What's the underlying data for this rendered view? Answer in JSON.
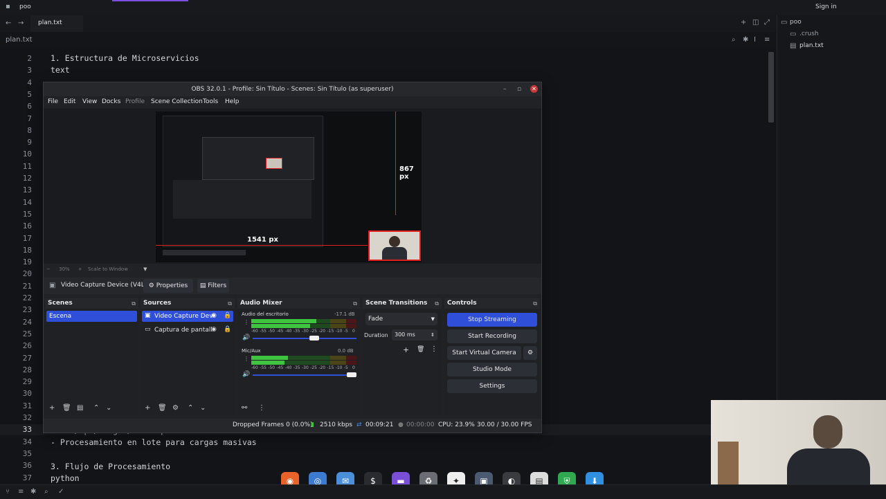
{
  "topbar": {
    "app": "poo",
    "signin": "Sign in"
  },
  "tab": {
    "label": "plan.txt"
  },
  "file_header": {
    "name": "plan.txt"
  },
  "sidebar": {
    "root": "poo",
    "items": [
      {
        "label": ".crush"
      },
      {
        "label": "plan.txt"
      }
    ]
  },
  "editor": {
    "line_numbers": [
      "2",
      "3",
      "4",
      "5",
      "6",
      "7",
      "8",
      "9",
      "10",
      "11",
      "12",
      "13",
      "14",
      "15",
      "16",
      "17",
      "18",
      "19",
      "20",
      "21",
      "22",
      "23",
      "24",
      "25",
      "26",
      "27",
      "28",
      "29",
      "30",
      "31",
      "32",
      "33",
      "34",
      "35",
      "36",
      "37"
    ],
    "lines": {
      "l2": "1. Estructura de Microservicios",
      "l3": "text",
      "l33": "POST /api/images/batch-process",
      "l34": "- Procesamiento en lote para cargas masivas",
      "l36": "3. Flujo de Procesamiento",
      "l37": "python"
    }
  },
  "obs": {
    "title": "OBS 32.0.1 - Profile: Sin Título - Scenes: Sin Título (as superuser)",
    "menu": [
      "File",
      "Edit",
      "View",
      "Docks",
      "Profile",
      "Scene Collection",
      "Tools",
      "Help"
    ],
    "preview": {
      "height_label": "867 px",
      "width_label": "1541 px",
      "zoom": "30%",
      "scale_mode": "Scale to Window"
    },
    "source_bar": {
      "source": "Video Capture Device (V4L",
      "properties": "Properties",
      "filters": "Filters"
    },
    "scenes": {
      "title": "Scenes",
      "items": [
        "Escena"
      ]
    },
    "sources": {
      "title": "Sources",
      "items": [
        "Video Capture Dev",
        "Captura de pantall"
      ]
    },
    "mixer": {
      "title": "Audio Mixer",
      "channels": [
        {
          "name": "Audio del escritorio",
          "db": "-17.1 dB",
          "level": 0.62,
          "volume": 0.6
        },
        {
          "name": "Mic/Aux",
          "db": "0.0 dB",
          "level": 0.35,
          "volume": 1.0
        }
      ],
      "scale": [
        "-60",
        "-55",
        "-50",
        "-45",
        "-40",
        "-35",
        "-30",
        "-25",
        "-20",
        "-15",
        "-10",
        "-5",
        "0"
      ]
    },
    "transitions": {
      "title": "Scene Transitions",
      "selected": "Fade",
      "duration_label": "Duration",
      "duration": "300 ms"
    },
    "controls": {
      "title": "Controls",
      "stop_streaming": "Stop Streaming",
      "start_recording": "Start Recording",
      "start_virtual_camera": "Start Virtual Camera",
      "studio_mode": "Studio Mode",
      "settings": "Settings"
    },
    "status": {
      "dropped": "Dropped Frames 0 (0.0%)",
      "bitrate": "2510 kbps",
      "stream_time": "00:09:21",
      "rec_time": "00:00:00",
      "cpu": "CPU: 23.9%",
      "fps": "30.00 / 30.00 FPS"
    }
  },
  "colors": {
    "accent_blue": "#2f4fd8",
    "meter_green": "#3ec43e",
    "meter_yellow": "#b8a72a",
    "meter_red": "#b5262e"
  }
}
